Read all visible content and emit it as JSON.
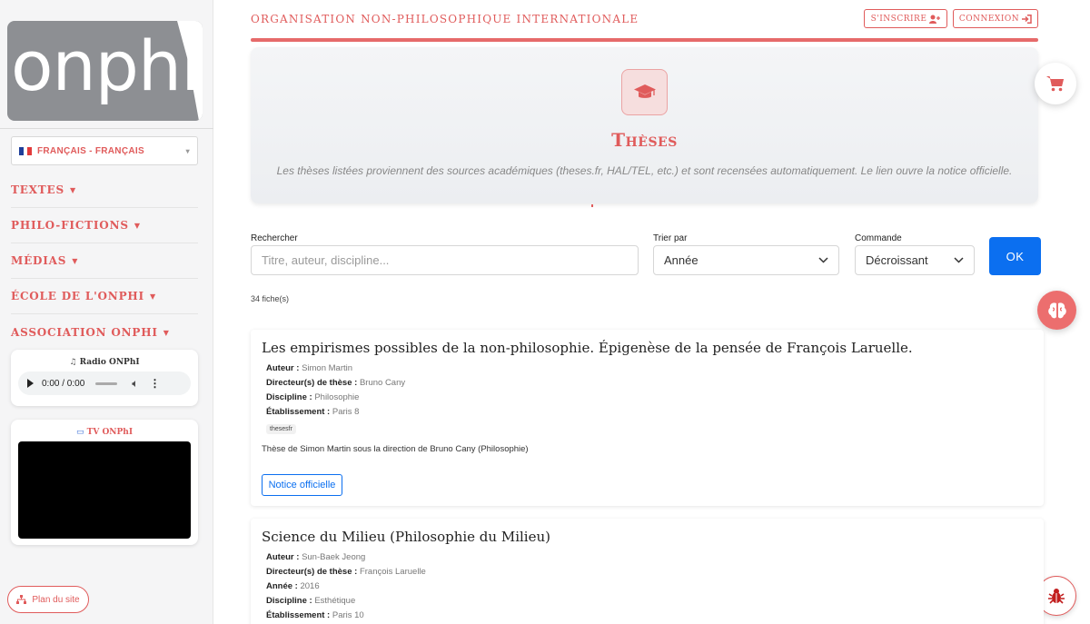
{
  "sidebar": {
    "logo_text": "onphi",
    "language": "FRANÇAIS - FRANÇAIS",
    "nav": [
      {
        "label": "TEXTES"
      },
      {
        "label": "PHILO-FICTIONS"
      },
      {
        "label": "MÉDIAS"
      },
      {
        "label": "ÉCOLE DE L'ONPHI"
      },
      {
        "label": "ASSOCIATION ONPHI"
      }
    ],
    "radio_title": "Radio ONPhI",
    "player_time": "0:00 / 0:00",
    "tv_title": "TV ONPhI",
    "plan_label": "Plan du site"
  },
  "header": {
    "title": "ORGANISATION NON-PHILOSOPHIQUE INTERNATIONALE",
    "signup": "S'INSCRIRE",
    "login": "CONNEXION"
  },
  "hero": {
    "title": "Thèses",
    "subtitle": "Les thèses listées proviennent des sources académiques (theses.fr, HAL/TEL, etc.) et sont recensées automatiquement. Le lien ouvre la notice officielle."
  },
  "filters": {
    "search_label": "Rechercher",
    "search_placeholder": "Titre, auteur, discipline...",
    "sort_label": "Trier par",
    "sort_value": "Année",
    "order_label": "Commande",
    "order_value": "Décroissant",
    "ok": "OK"
  },
  "count": "34 fiche(s)",
  "results": [
    {
      "title": "Les empirismes possibles de la non-philosophie. Épigenèse de la pensée de François Laruelle.",
      "fields": [
        {
          "label": "Auteur :",
          "value": "Simon Martin"
        },
        {
          "label": "Directeur(s) de thèse :",
          "value": "Bruno Cany"
        },
        {
          "label": "Discipline :",
          "value": "Philosophie"
        },
        {
          "label": "Établissement :",
          "value": "Paris 8"
        }
      ],
      "tag": "thesesfr",
      "description": "Thèse de Simon Martin sous la direction de Bruno Cany (Philosophie)",
      "button": "Notice officielle"
    },
    {
      "title": "Science du Milieu (Philosophie du Milieu)",
      "fields": [
        {
          "label": "Auteur :",
          "value": "Sun-Baek Jeong"
        },
        {
          "label": "Directeur(s) de thèse :",
          "value": "François Laruelle"
        },
        {
          "label": "Année :",
          "value": "2016"
        },
        {
          "label": "Discipline :",
          "value": "Esthétique"
        },
        {
          "label": "Établissement :",
          "value": "Paris 10"
        }
      ]
    }
  ],
  "colors": {
    "accent": "#e05b5b",
    "primary_button": "#0b6ff0"
  }
}
